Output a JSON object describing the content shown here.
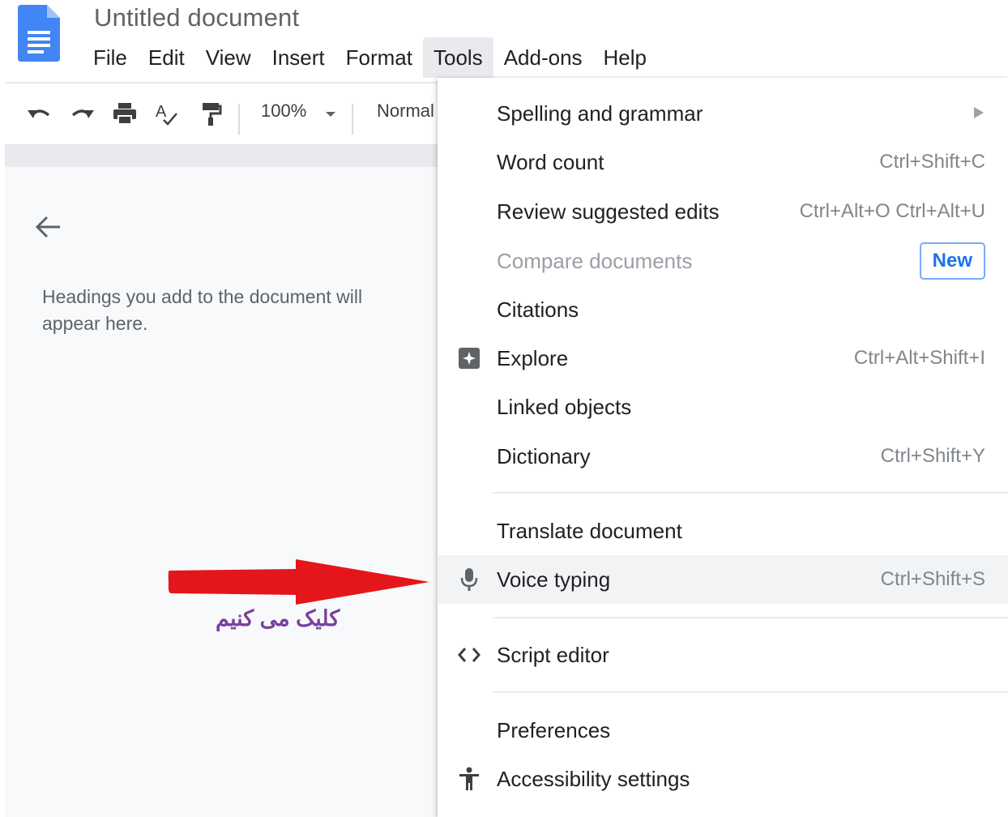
{
  "document": {
    "title": "Untitled document"
  },
  "menubar": {
    "items": [
      {
        "label": "File"
      },
      {
        "label": "Edit"
      },
      {
        "label": "View"
      },
      {
        "label": "Insert"
      },
      {
        "label": "Format"
      },
      {
        "label": "Tools",
        "active": true
      },
      {
        "label": "Add-ons"
      },
      {
        "label": "Help"
      }
    ]
  },
  "toolbar": {
    "icons": [
      "undo-icon",
      "redo-icon",
      "print-icon",
      "spellcheck-icon",
      "paint-format-icon"
    ],
    "zoom": "100%",
    "style": "Normal"
  },
  "outline": {
    "placeholder": "Headings you add to the document will appear here."
  },
  "annotation": {
    "text": "کلیک می کنیم",
    "arrow_color": "#e4161b",
    "text_color": "#7b3fa0"
  },
  "tools_menu": {
    "items": [
      {
        "label": "Spelling and grammar",
        "shortcut": "",
        "icon": "",
        "submenu": true
      },
      {
        "label": "Word count",
        "shortcut": "Ctrl+Shift+C",
        "icon": ""
      },
      {
        "label": "Review suggested edits",
        "shortcut": "Ctrl+Alt+O Ctrl+Alt+U",
        "icon": ""
      },
      {
        "label": "Compare documents",
        "shortcut": "",
        "icon": "",
        "disabled": true,
        "badge": "New"
      },
      {
        "label": "Citations",
        "shortcut": "",
        "icon": ""
      },
      {
        "label": "Explore",
        "shortcut": "Ctrl+Alt+Shift+I",
        "icon": "explore-icon"
      },
      {
        "label": "Linked objects",
        "shortcut": "",
        "icon": ""
      },
      {
        "label": "Dictionary",
        "shortcut": "Ctrl+Shift+Y",
        "icon": ""
      },
      {
        "label": "Translate document",
        "shortcut": "",
        "icon": ""
      },
      {
        "label": "Voice typing",
        "shortcut": "Ctrl+Shift+S",
        "icon": "microphone-icon",
        "highlighted": true
      },
      {
        "label": "Script editor",
        "shortcut": "",
        "icon": "code-icon"
      },
      {
        "label": "Preferences",
        "shortcut": "",
        "icon": ""
      },
      {
        "label": "Accessibility settings",
        "shortcut": "",
        "icon": "accessibility-icon"
      }
    ]
  },
  "colors": {
    "docs_blue": "#4285f4",
    "menu_highlight": "#f1f3f4",
    "badge_blue": "#1a73e8"
  }
}
